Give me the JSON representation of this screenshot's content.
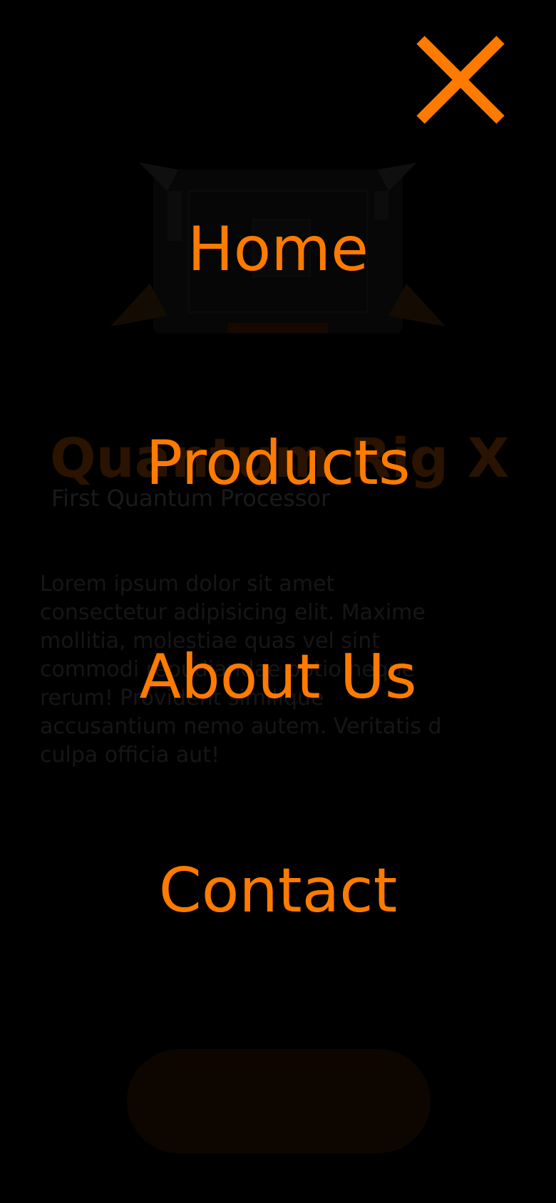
{
  "background": {
    "product": {
      "title": "Quantum Rig X",
      "subtitle": "First Quantum Processor",
      "description": "Lorem ipsum dolor sit amet\nconsectetur adipisicing elit. Maxime\nmollitia, molestiae quas vel sint\ncommodi repudiandae optio neque\nrerum! Provident similique\naccusantium nemo autem. Veritatis d\nculpa officia aut!"
    }
  },
  "menu": {
    "close_icon": "close-icon",
    "items": [
      {
        "label": "Home"
      },
      {
        "label": "Products"
      },
      {
        "label": "About Us"
      },
      {
        "label": "Contact"
      }
    ]
  },
  "colors": {
    "accent": "#ff7b00",
    "background": "#000000"
  }
}
